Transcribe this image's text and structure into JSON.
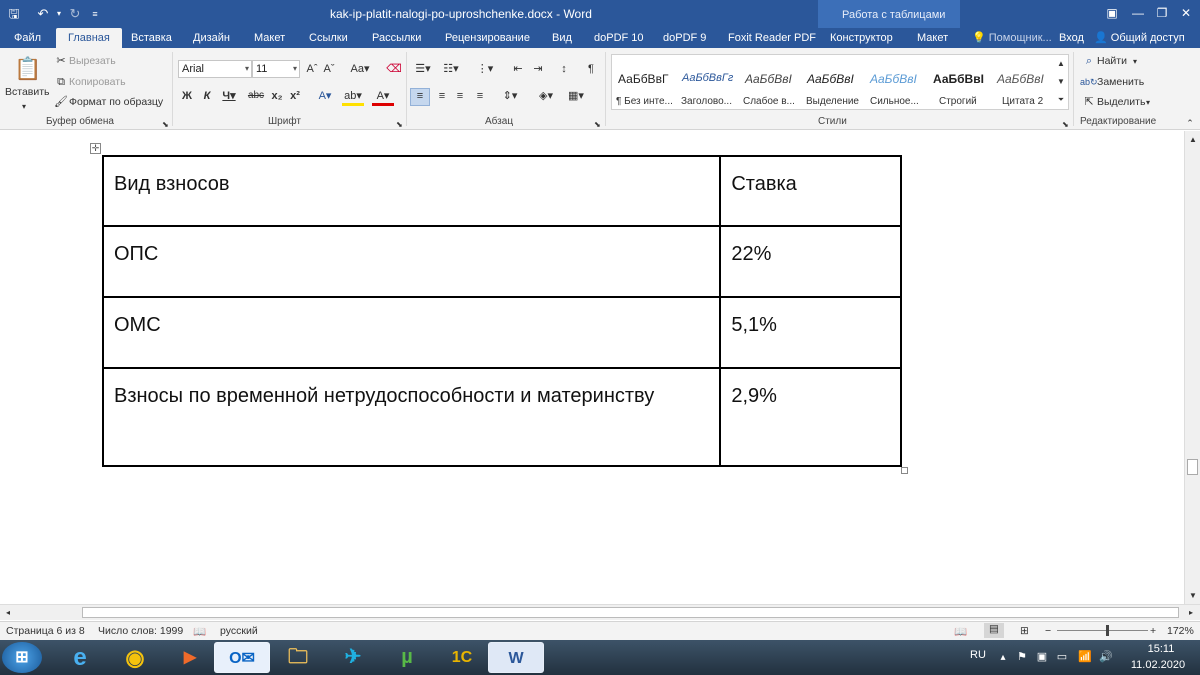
{
  "window": {
    "doc_title": "kak-ip-platit-nalogi-po-uproshchenke.docx - Word",
    "context_group": "Работа с таблицами"
  },
  "tabs": [
    "Файл",
    "Главная",
    "Вставка",
    "Дизайн",
    "Макет",
    "Ссылки",
    "Рассылки",
    "Рецензирование",
    "Вид",
    "doPDF 10",
    "doPDF 9",
    "Foxit Reader PDF",
    "Конструктор",
    "Макет",
    "Помощник...",
    "Вход",
    "Общий доступ"
  ],
  "ribbon": {
    "clipboard": {
      "paste": "Вставить",
      "cut": "Вырезать",
      "copy": "Копировать",
      "format_painter": "Формат по образцу",
      "label": "Буфер обмена"
    },
    "font": {
      "name": "Arial",
      "size": "11",
      "label": "Шрифт"
    },
    "paragraph": {
      "label": "Абзац"
    },
    "styles": {
      "label": "Стили",
      "items": [
        {
          "preview": "АаБбВвГ",
          "name": "¶ Без инте..."
        },
        {
          "preview": "АаБбВвГг",
          "name": "Заголово..."
        },
        {
          "preview": "АаБбВвІ",
          "name": "Слабое в..."
        },
        {
          "preview": "АаБбВвІ",
          "name": "Выделение"
        },
        {
          "preview": "АаБбВвІ",
          "name": "Сильное..."
        },
        {
          "preview": "АаБбВвІ",
          "name": "Строгий"
        },
        {
          "preview": "АаБбВвІ",
          "name": "Цитата 2"
        }
      ]
    },
    "editing": {
      "find": "Найти",
      "replace": "Заменить",
      "select": "Выделить",
      "label": "Редактирование"
    }
  },
  "table": {
    "rows": [
      [
        "Вид взносов",
        "Ставка"
      ],
      [
        "ОПС",
        "22%"
      ],
      [
        "ОМС",
        "5,1%"
      ],
      [
        "Взносы по временной нетрудоспособности и материнству",
        "2,9%"
      ]
    ]
  },
  "status": {
    "page": "Страница 6 из 8",
    "words": "Число слов: 1999",
    "language": "русский",
    "zoom": "172%"
  },
  "tray": {
    "lang": "RU",
    "time": "15:11",
    "date": "11.02.2020"
  }
}
